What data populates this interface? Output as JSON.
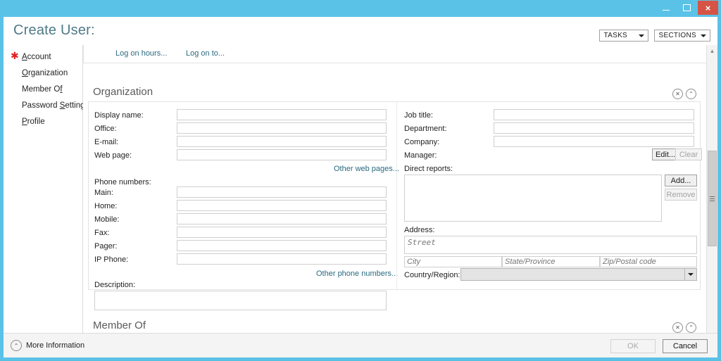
{
  "window": {
    "frame_color": "#5bc2e7",
    "buttons": {
      "minimize": "–",
      "maximize": "□",
      "close": "×"
    }
  },
  "header": {
    "title": "Create User:",
    "tasks_button": "TASKS",
    "sections_button": "SECTIONS"
  },
  "sidebar": {
    "items": [
      {
        "label": "Account",
        "accel": "A",
        "required": true
      },
      {
        "label": "Organization",
        "accel": "O",
        "required": false
      },
      {
        "label": "Member Of",
        "accel": "f",
        "required": false
      },
      {
        "label": "Password Settings",
        "accel": "S",
        "required": false
      },
      {
        "label": "Profile",
        "accel": "P",
        "required": false
      }
    ]
  },
  "toolbar": {
    "logon_hours": "Log on hours...",
    "logon_to": "Log on to..."
  },
  "organization": {
    "heading": "Organization",
    "left": {
      "display_name": {
        "label": "Display name:",
        "value": ""
      },
      "office": {
        "label": "Office:",
        "value": ""
      },
      "email": {
        "label": "E-mail:",
        "value": ""
      },
      "web_page": {
        "label": "Web page:",
        "value": ""
      },
      "other_web_pages": "Other web pages...",
      "phone_numbers_label": "Phone numbers:",
      "phones": [
        {
          "label": "Main:",
          "value": ""
        },
        {
          "label": "Home:",
          "value": ""
        },
        {
          "label": "Mobile:",
          "value": ""
        },
        {
          "label": "Fax:",
          "value": ""
        },
        {
          "label": "Pager:",
          "value": ""
        },
        {
          "label": "IP Phone:",
          "value": ""
        }
      ],
      "other_phone_numbers": "Other phone numbers...",
      "description": {
        "label": "Description:",
        "value": ""
      }
    },
    "right": {
      "job_title": {
        "label": "Job title:",
        "value": ""
      },
      "department": {
        "label": "Department:",
        "value": ""
      },
      "company": {
        "label": "Company:",
        "value": ""
      },
      "manager": {
        "label": "Manager:",
        "edit_button": "Edit...",
        "clear_button": "Clear",
        "clear_disabled": true
      },
      "direct_reports": {
        "label": "Direct reports:",
        "add_button": "Add...",
        "remove_button": "Remove",
        "remove_disabled": true,
        "items": []
      },
      "address": {
        "label": "Address:",
        "street_placeholder": "Street",
        "street_value": "",
        "city_placeholder": "City",
        "city_value": "",
        "state_placeholder": "State/Province",
        "state_value": "",
        "zip_placeholder": "Zip/Postal code",
        "zip_value": "",
        "country_label": "Country/Region:",
        "country_value": ""
      }
    },
    "icons": {
      "remove": "✕",
      "collapse": "⌃"
    }
  },
  "member_of": {
    "heading": "Member Of",
    "icons": {
      "remove": "✕",
      "collapse": "⌃"
    }
  },
  "scrollbar": {
    "up_arrow": "▲",
    "down_arrow": "▼"
  },
  "footer": {
    "more_information": "More Information",
    "more_information_icon": "⌃",
    "ok_button": "OK",
    "ok_disabled": true,
    "cancel_button": "Cancel"
  }
}
